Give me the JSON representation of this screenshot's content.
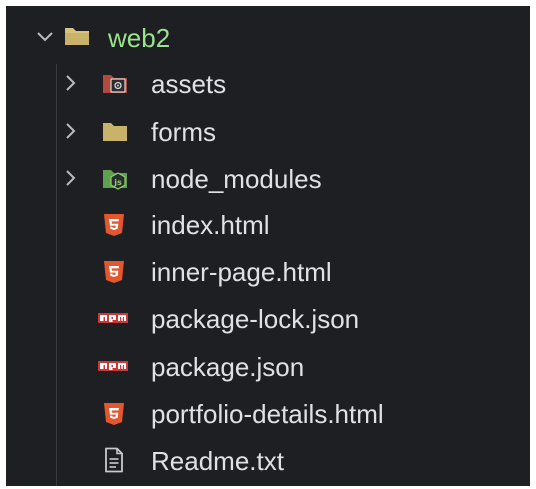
{
  "explorer": {
    "root": {
      "label": "web2",
      "expanded": true,
      "icon": "folder-open-icon"
    },
    "items": [
      {
        "label": "assets",
        "type": "folder",
        "icon": "assets-folder-icon",
        "expandable": true
      },
      {
        "label": "forms",
        "type": "folder",
        "icon": "folder-icon",
        "expandable": true
      },
      {
        "label": "node_modules",
        "type": "folder",
        "icon": "nodejs-folder-icon",
        "expandable": true
      },
      {
        "label": "index.html",
        "type": "file",
        "icon": "html5-icon"
      },
      {
        "label": "inner-page.html",
        "type": "file",
        "icon": "html5-icon"
      },
      {
        "label": "package-lock.json",
        "type": "file",
        "icon": "npm-icon"
      },
      {
        "label": "package.json",
        "type": "file",
        "icon": "npm-icon"
      },
      {
        "label": "portfolio-details.html",
        "type": "file",
        "icon": "html5-icon"
      },
      {
        "label": "Readme.txt",
        "type": "file",
        "icon": "text-file-icon"
      }
    ]
  },
  "colors": {
    "background": "#1e1f22",
    "text": "#dfe1e5",
    "root_text": "#9be38b",
    "folder": "#c9b26a",
    "html5": "#e4572e",
    "npm": "#cb3837",
    "nodejs": "#5fa04e",
    "assets_folder": "#c0574b"
  }
}
